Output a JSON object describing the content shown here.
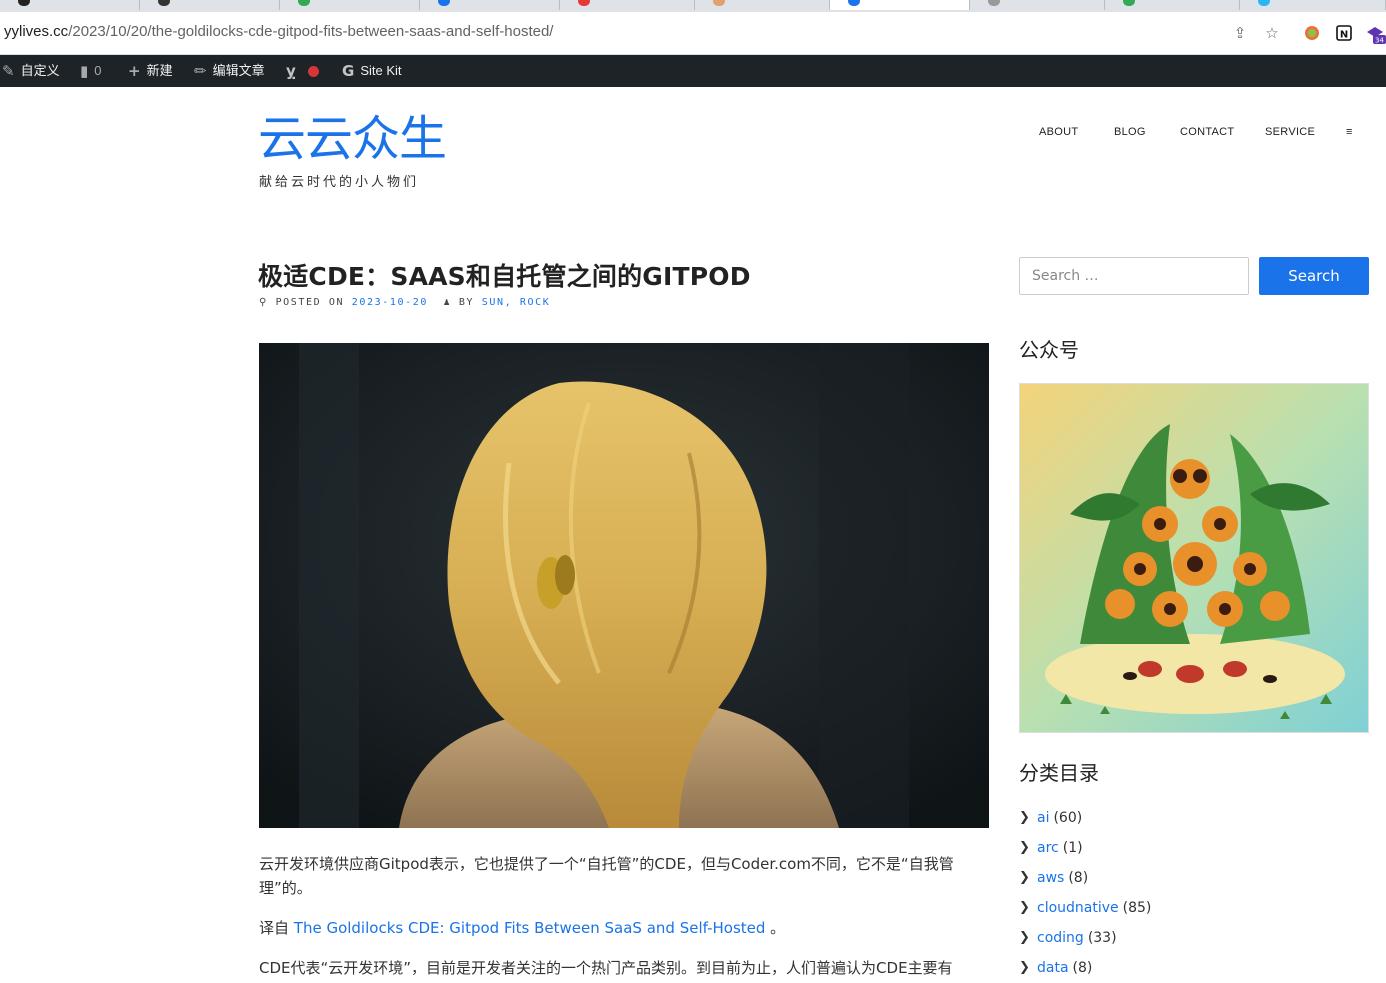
{
  "browser": {
    "url_host": "yylives.cc",
    "url_path": "/2023/10/20/the-goldilocks-cde-gitpod-fits-between-saas-and-self-hosted/",
    "extension_badge": "34"
  },
  "adminbar": {
    "customize": "自定义",
    "comments_count": "0",
    "new": "新建",
    "edit_post": "编辑文章",
    "site_kit": "Site Kit"
  },
  "site": {
    "title": "云云众生",
    "description": "献给云时代的小人物们"
  },
  "nav": {
    "items": [
      "ABOUT",
      "BLOG",
      "CONTACT",
      "SERVICE",
      "≡"
    ]
  },
  "post": {
    "title": "极适CDE：SAAS和自托管之间的GITPOD",
    "posted_on_label": "POSTED ON",
    "date": "2023-10-20",
    "by_label": "BY",
    "author_1": "SUN",
    "author_sep": ",",
    "author_2": "ROCK",
    "para1": "云开发环境供应商Gitpod表示，它也提供了一个“自托管”的CDE，但与Coder.com不同，它不是“自我管理”的。",
    "para2_prefix": "译自 ",
    "para2_link": "The Goldilocks CDE: Gitpod Fits Between SaaS and Self-Hosted",
    "para2_suffix": " 。",
    "para3": "CDE代表“云开发环境”，目前是开发者关注的一个热门产品类别。到目前为止，人们普遍认为CDE主要有"
  },
  "sidebar": {
    "search_placeholder": "Search …",
    "search_button": "Search",
    "wechat_title": "公众号",
    "categories_title": "分类目录",
    "categories": [
      {
        "name": "ai",
        "count": "(60)"
      },
      {
        "name": "arc",
        "count": "(1)"
      },
      {
        "name": "aws",
        "count": "(8)"
      },
      {
        "name": "cloudnative",
        "count": "(85)"
      },
      {
        "name": "coding",
        "count": "(33)"
      },
      {
        "name": "data",
        "count": "(8)"
      }
    ]
  },
  "colors": {
    "accent": "#1a73e8",
    "adminbar": "#1d2327"
  }
}
